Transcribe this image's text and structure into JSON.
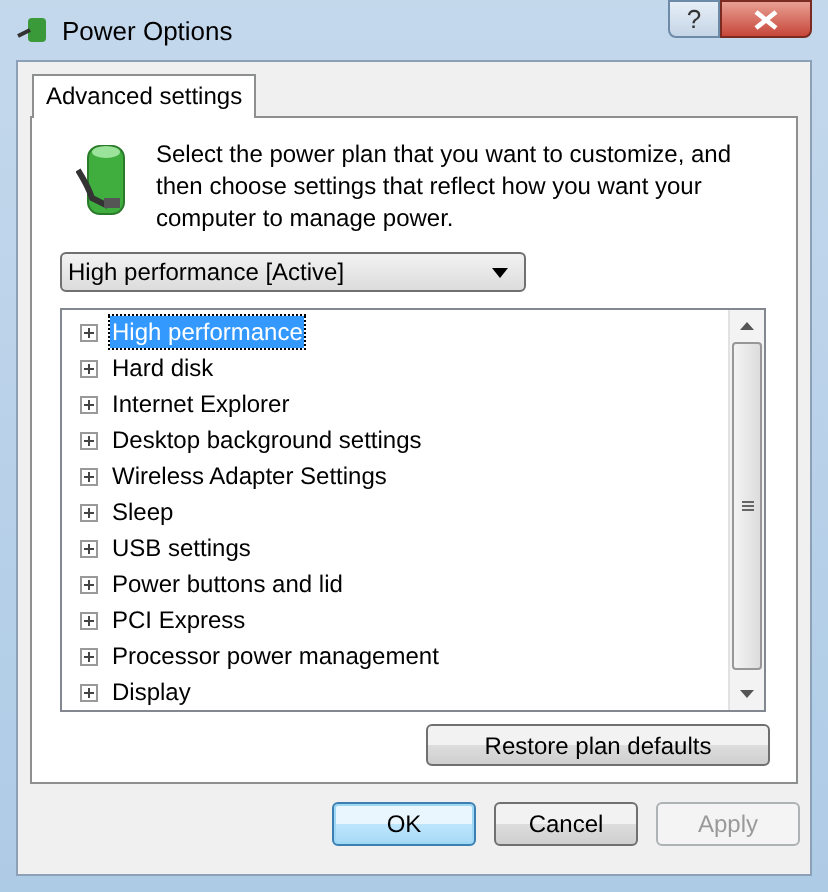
{
  "window": {
    "title": "Power Options",
    "help": "?"
  },
  "tabs": [
    {
      "label": "Advanced settings",
      "selected": true
    }
  ],
  "intro": "Select the power plan that you want to customize, and then choose settings that reflect how you want your computer to manage power.",
  "plan_dropdown": {
    "value": "High performance [Active]"
  },
  "tree": [
    {
      "label": "High performance",
      "expanded": false,
      "selected": true
    },
    {
      "label": "Hard disk",
      "expanded": false,
      "selected": false
    },
    {
      "label": "Internet Explorer",
      "expanded": false,
      "selected": false
    },
    {
      "label": "Desktop background settings",
      "expanded": false,
      "selected": false
    },
    {
      "label": "Wireless Adapter Settings",
      "expanded": false,
      "selected": false
    },
    {
      "label": "Sleep",
      "expanded": false,
      "selected": false
    },
    {
      "label": "USB settings",
      "expanded": false,
      "selected": false
    },
    {
      "label": "Power buttons and lid",
      "expanded": false,
      "selected": false
    },
    {
      "label": "PCI Express",
      "expanded": false,
      "selected": false
    },
    {
      "label": "Processor power management",
      "expanded": false,
      "selected": false
    },
    {
      "label": "Display",
      "expanded": false,
      "selected": false
    }
  ],
  "restore_button": "Restore plan defaults",
  "buttons": [
    {
      "label": "OK",
      "default": true,
      "disabled": false
    },
    {
      "label": "Cancel",
      "default": false,
      "disabled": false
    },
    {
      "label": "Apply",
      "default": false,
      "disabled": true
    }
  ]
}
